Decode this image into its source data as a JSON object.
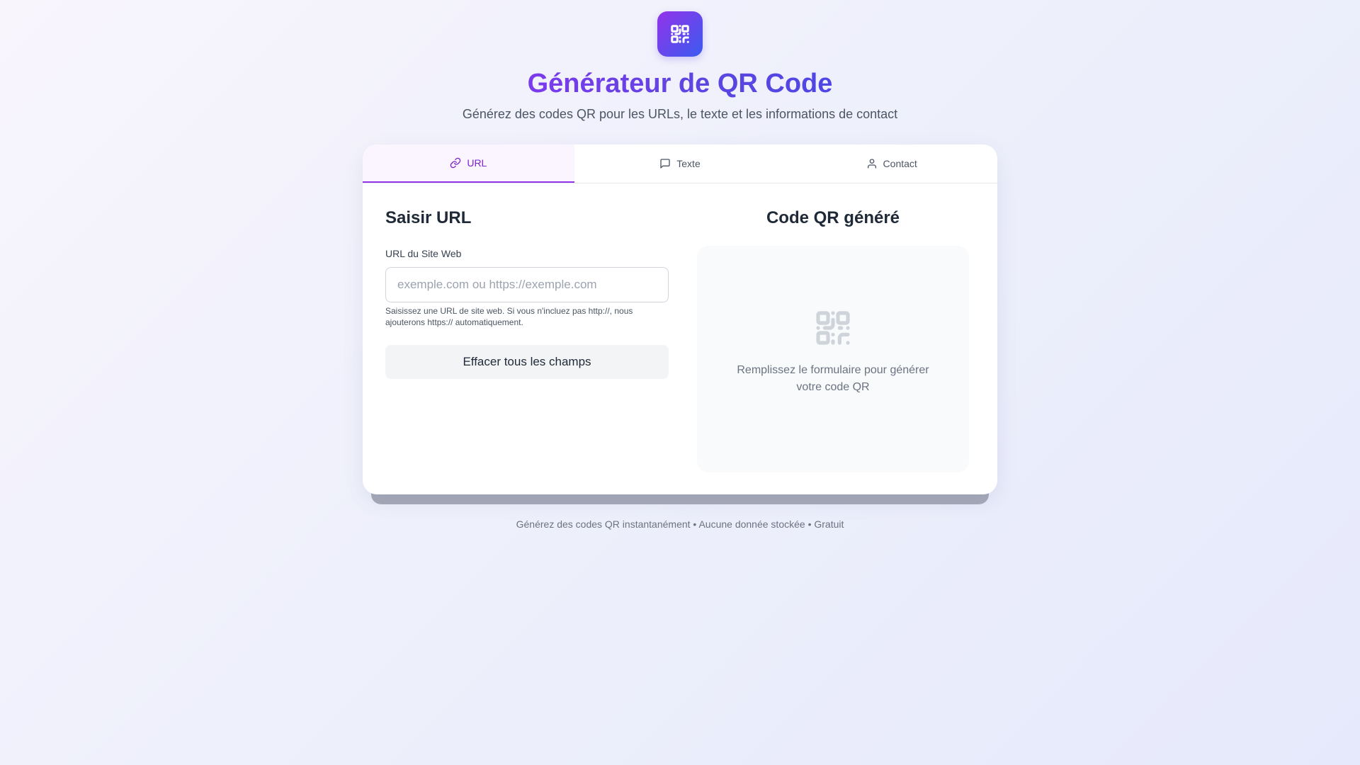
{
  "header": {
    "logo_icon": "qr-code-icon",
    "title": "Générateur de QR Code",
    "subtitle": "Générez des codes QR pour les URLs, le texte et les informations de contact"
  },
  "tabs": [
    {
      "label": "URL",
      "icon": "link-icon",
      "active": true
    },
    {
      "label": "Texte",
      "icon": "message-square-icon",
      "active": false
    },
    {
      "label": "Contact",
      "icon": "user-icon",
      "active": false
    }
  ],
  "form": {
    "title": "Saisir URL",
    "field_label": "URL du Site Web",
    "input_value": "",
    "input_placeholder": "exemple.com ou https://exemple.com",
    "hint": "Saisissez une URL de site web. Si vous n'incluez pas http://, nous ajouterons https:// automatiquement.",
    "clear_button": "Effacer tous les champs"
  },
  "result": {
    "title": "Code QR généré",
    "empty_icon": "qr-code-icon",
    "empty_text": "Remplissez le formulaire pour générer votre code QR"
  },
  "footer": {
    "text": "Générez des codes QR instantanément • Aucune donnée stockée • Gratuit"
  },
  "colors": {
    "accent": "#9333ea",
    "accent_secondary": "#3b5bf0",
    "active_tab_bg": "#faf5ff"
  }
}
